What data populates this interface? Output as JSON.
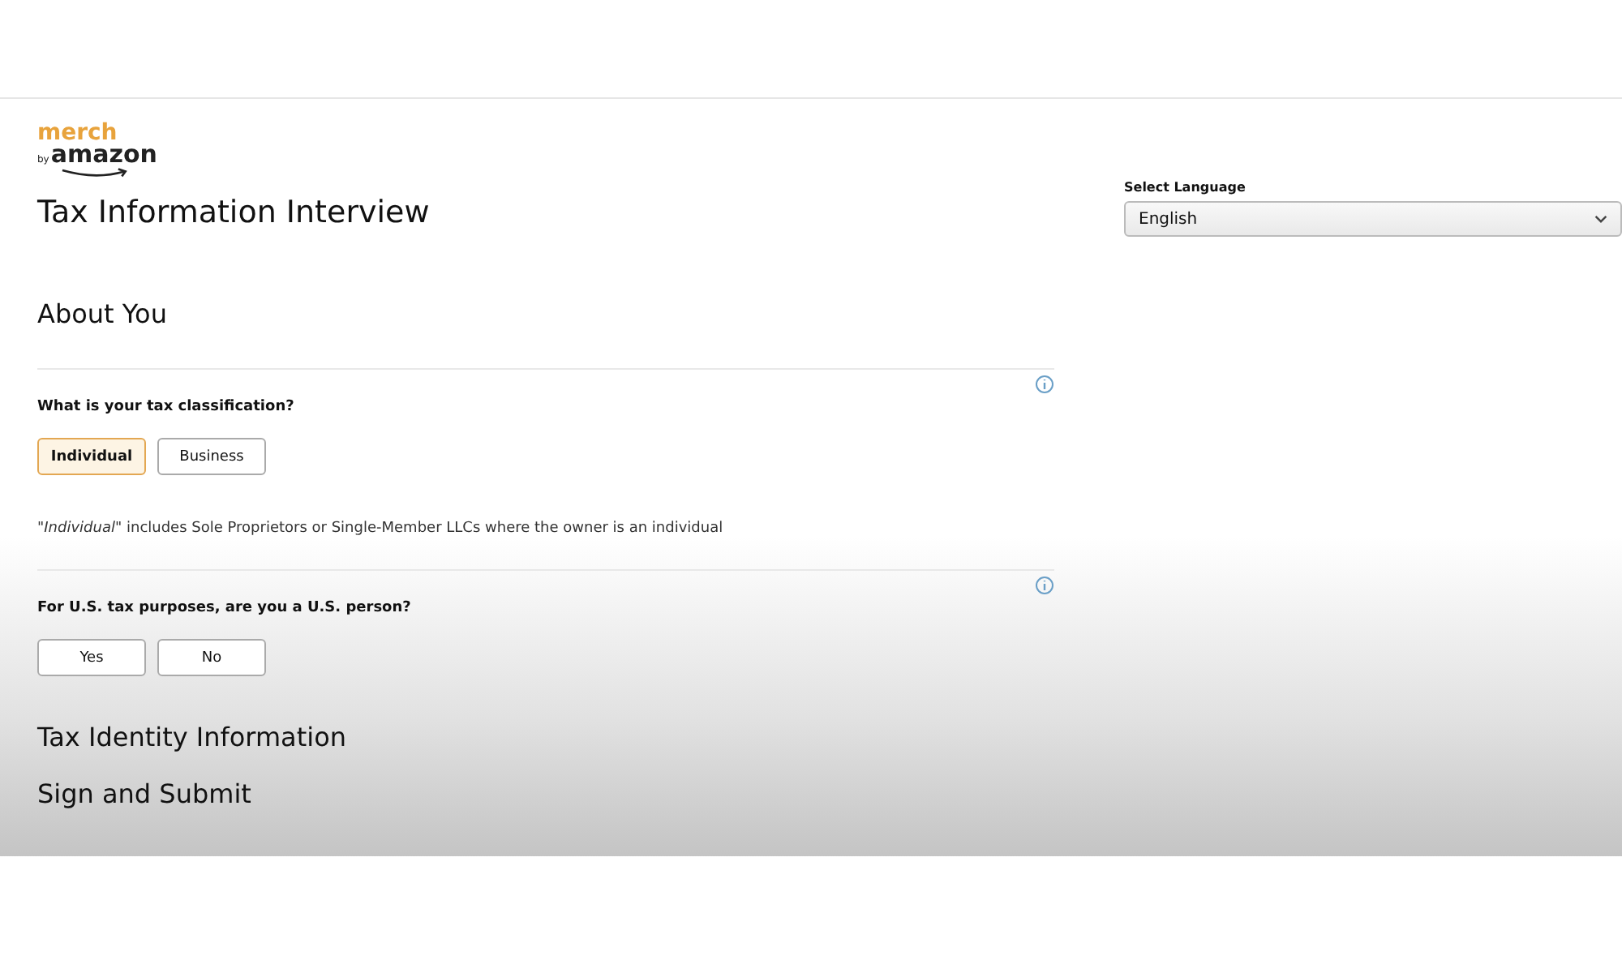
{
  "logo": {
    "top": "merch",
    "by": "by",
    "bottom": "amazon"
  },
  "title": "Tax Information Interview",
  "language": {
    "label": "Select Language",
    "value": "English"
  },
  "sections": [
    {
      "heading": "About You",
      "questions": [
        {
          "text": "What is your tax classification?",
          "options": [
            {
              "label": "Individual",
              "selected": true
            },
            {
              "label": "Business",
              "selected": false
            }
          ],
          "hint": "\"*Individual*\" includes Sole Proprietors or Single-Member LLCs where the owner is an individual"
        },
        {
          "text": "For U.S. tax purposes, are you a U.S. person?",
          "options": [
            {
              "label": "Yes",
              "selected": false
            },
            {
              "label": "No",
              "selected": false
            }
          ]
        }
      ]
    },
    {
      "heading": "Tax Identity Information"
    },
    {
      "heading": "Sign and Submit"
    }
  ]
}
